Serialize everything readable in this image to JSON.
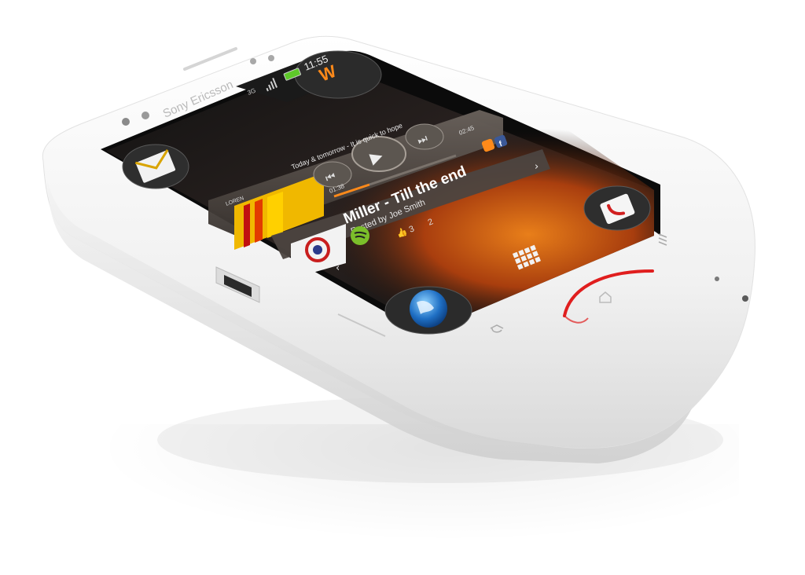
{
  "brand": "Sony Ericsson",
  "status_bar": {
    "network": "3G",
    "time": "11:55"
  },
  "music_widget": {
    "track_title": "Today & tomorrow - It is quick to hope",
    "elapsed": "01:38",
    "duration": "02:45",
    "album_label": "LOREN",
    "post_title": "Miller - Till the end",
    "post_author": "Posted by Joe Smith",
    "likes": "3",
    "comments": "2"
  },
  "icons": {
    "walkman": "walkman-logo",
    "messaging": "envelope-icon",
    "phone": "phone-icon",
    "browser": "globe-icon",
    "apps": "app-grid-icon",
    "menu": "menu-icon",
    "home": "home-icon",
    "back": "back-icon"
  },
  "colors": {
    "phone_body": "#f7f7f7",
    "accent_orange": "#ff7a12",
    "home_button_red": "#e01e1e",
    "screen_dark": "#1d1d1d"
  }
}
